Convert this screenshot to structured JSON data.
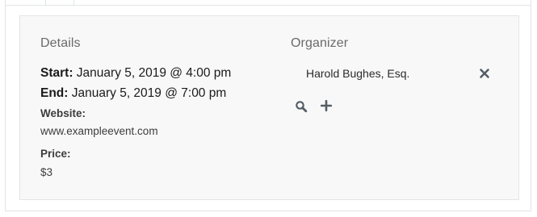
{
  "details": {
    "heading": "Details",
    "start_label": "Start:",
    "start_value": "January 5, 2019 @ 4:00 pm",
    "end_label": "End:",
    "end_value": "January 5, 2019 @ 7:00 pm",
    "website_label": "Website:",
    "website_value": "www.exampleevent.com",
    "price_label": "Price:",
    "price_value": "$3"
  },
  "organizer": {
    "heading": "Organizer",
    "name": "Harold Bughes, Esq.",
    "icons": {
      "remove": "close-icon",
      "search": "search-icon",
      "add": "plus-icon"
    }
  },
  "colors": {
    "panel_bg": "#f8f8f8",
    "heading_text": "#6a6a6a",
    "body_text": "#1a1a1a",
    "icon": "#555d66"
  }
}
